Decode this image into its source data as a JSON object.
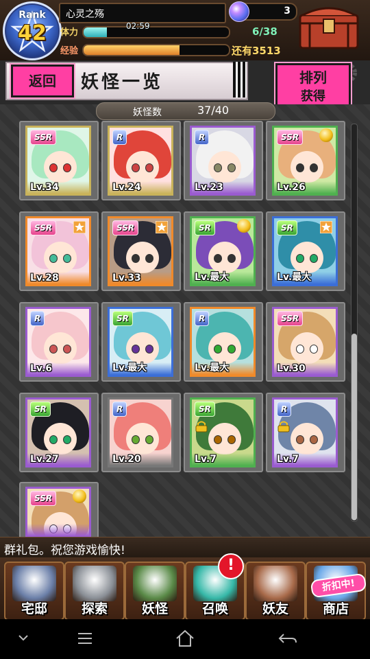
{
  "status": {
    "rank_label": "Rank",
    "rank_value": "42",
    "player_name": "心灵之殇",
    "gems": "3",
    "stamina_label": "体力",
    "stamina_timer": "02:59",
    "stamina_value": "6/38",
    "stamina_fill_fraction": 0.16,
    "exp_label": "经验",
    "exp_fill_fraction": 0.66,
    "exp_remaining": "还有3513"
  },
  "header": {
    "back_label": "返回",
    "title": "妖怪一览",
    "sort_label_1": "排列",
    "sort_label_2": "获得"
  },
  "count": {
    "label": "妖怪数",
    "value": "37/40"
  },
  "cards": [
    {
      "rarity": "SSR",
      "level": "Lv.34",
      "hair": "#a8e8c0",
      "bg": "#dff6e8",
      "eye": "#d33",
      "frame": "#c9b35a",
      "badge": "none"
    },
    {
      "rarity": "R",
      "level": "Lv.24",
      "hair": "#e0453a",
      "bg": "#ffe0e0",
      "eye": "#c44",
      "frame": "#c9b35a",
      "badge": "none"
    },
    {
      "rarity": "R",
      "level": "Lv.23",
      "hair": "#f2f2f2",
      "bg": "#d8d8e4",
      "eye": "#886",
      "frame": "#9a5bd0",
      "badge": "none"
    },
    {
      "rarity": "SSR",
      "level": "Lv.26",
      "hair": "#e8b07c",
      "bg": "#cfe9a4",
      "eye": "#333",
      "frame": "#4fb04f",
      "badge": "medal"
    },
    {
      "rarity": "SSR",
      "level": "Lv.28",
      "hair": "#f2c3d9",
      "bg": "#f8dfe6",
      "eye": "#4b9",
      "frame": "#f08a2a",
      "badge": "star"
    },
    {
      "rarity": "SSR",
      "level": "Lv.33",
      "hair": "#2c2c36",
      "bg": "#b89c86",
      "eye": "#333",
      "frame": "#f08a2a",
      "badge": "star"
    },
    {
      "rarity": "SR",
      "level": "Lv.最大",
      "hair": "#7b4db8",
      "bg": "#b9e89a",
      "eye": "#333",
      "frame": "#4fb04f",
      "badge": "medal"
    },
    {
      "rarity": "SR",
      "level": "Lv.最大",
      "hair": "#2f8ea8",
      "bg": "#8fcfe6",
      "eye": "#2a6",
      "frame": "#3b6ed8",
      "badge": "star"
    },
    {
      "rarity": "R",
      "level": "Lv.6",
      "hair": "#f6c6cc",
      "bg": "#fde8ea",
      "eye": "#c55",
      "frame": "#9a5bd0",
      "badge": "none"
    },
    {
      "rarity": "SR",
      "level": "Lv.最大",
      "hair": "#6fc7d6",
      "bg": "#d8eef5",
      "eye": "#639",
      "frame": "#3b6ed8",
      "badge": "none"
    },
    {
      "rarity": "R",
      "level": "Lv.最大",
      "hair": "#4cb5b0",
      "bg": "#b6e0de",
      "eye": "#3a3",
      "frame": "#f08a2a",
      "badge": "none"
    },
    {
      "rarity": "SSR",
      "level": "Lv.30",
      "hair": "#d6a66a",
      "bg": "#f3deb8",
      "eye": "#fff",
      "frame": "#9a5bd0",
      "badge": "none"
    },
    {
      "rarity": "SR",
      "level": "Lv.27",
      "hair": "#1e1e24",
      "bg": "#d4c0b0",
      "eye": "#2a6",
      "frame": "#9a5bd0",
      "badge": "none"
    },
    {
      "rarity": "R",
      "level": "Lv.20",
      "hair": "#ef7f7a",
      "bg": "#f7d3cf",
      "eye": "#6a3",
      "frame": "#777",
      "badge": "none"
    },
    {
      "rarity": "SR",
      "level": "Lv.7",
      "hair": "#3f7a3a",
      "bg": "#c9d98c",
      "eye": "#a60",
      "frame": "#4fb04f",
      "badge": "lock"
    },
    {
      "rarity": "R",
      "level": "Lv.7",
      "hair": "#6f85a8",
      "bg": "#dfe3ee",
      "eye": "#a64",
      "frame": "#9a5bd0",
      "badge": "lock"
    },
    {
      "rarity": "SSR",
      "level": "",
      "hair": "#d3a06a",
      "bg": "#f3deb8",
      "eye": "#fff",
      "frame": "#9a5bd0",
      "badge": "medal"
    }
  ],
  "ticker": {
    "text": "群礼包。祝您游戏愉快!"
  },
  "nav": [
    {
      "label": "宅邸",
      "icon": "house-icon",
      "color": "#6b7fa8"
    },
    {
      "label": "探索",
      "icon": "magnifier-icon",
      "color": "#8a8f96"
    },
    {
      "label": "妖怪",
      "icon": "scroll-icon",
      "color": "#5a8a48"
    },
    {
      "label": "召唤",
      "icon": "pentagram-icon",
      "color": "#36b8a8"
    },
    {
      "label": "妖友",
      "icon": "friend-icon",
      "color": "#a86a4a"
    },
    {
      "label": "商店",
      "icon": "shop-orb-icon",
      "color": "#6aa8e8"
    }
  ],
  "nav_badge": "!",
  "shop_sale": "折扣中!"
}
